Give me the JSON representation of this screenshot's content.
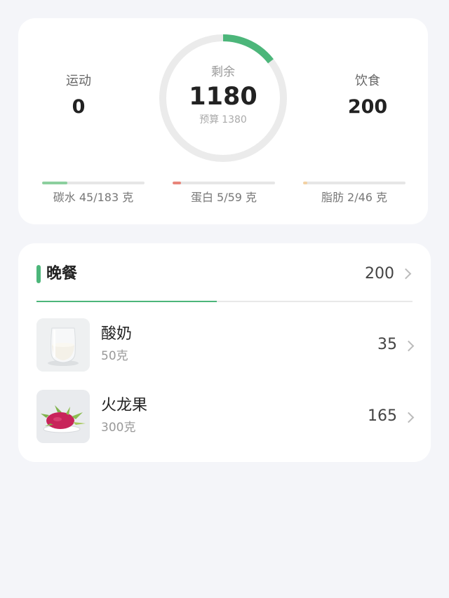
{
  "summary": {
    "exercise": {
      "label": "运动",
      "value": "0"
    },
    "intake": {
      "label": "饮食",
      "value": "200"
    },
    "remaining": {
      "label": "剩余",
      "value": "1180",
      "budget_label": "预算",
      "budget_value": "1380",
      "progress": 0.145
    },
    "macros": [
      {
        "text": "碳水 45/183 克",
        "progress": 0.246,
        "color": "#8ccf9e"
      },
      {
        "text": "蛋白 5/59 克",
        "progress": 0.085,
        "color": "#e8857a"
      },
      {
        "text": "脂肪 2/46 克",
        "progress": 0.043,
        "color": "#f3d1a3"
      }
    ],
    "ring_color": "#4cb67a",
    "ring_track_color": "#ebebeb"
  },
  "meal": {
    "title": "晚餐",
    "total": "200",
    "progress": 0.48,
    "items": [
      {
        "name": "酸奶",
        "amount": "50克",
        "kcal": "35",
        "icon": "yogurt-image"
      },
      {
        "name": "火龙果",
        "amount": "300克",
        "kcal": "165",
        "icon": "dragon-fruit-image"
      }
    ]
  }
}
